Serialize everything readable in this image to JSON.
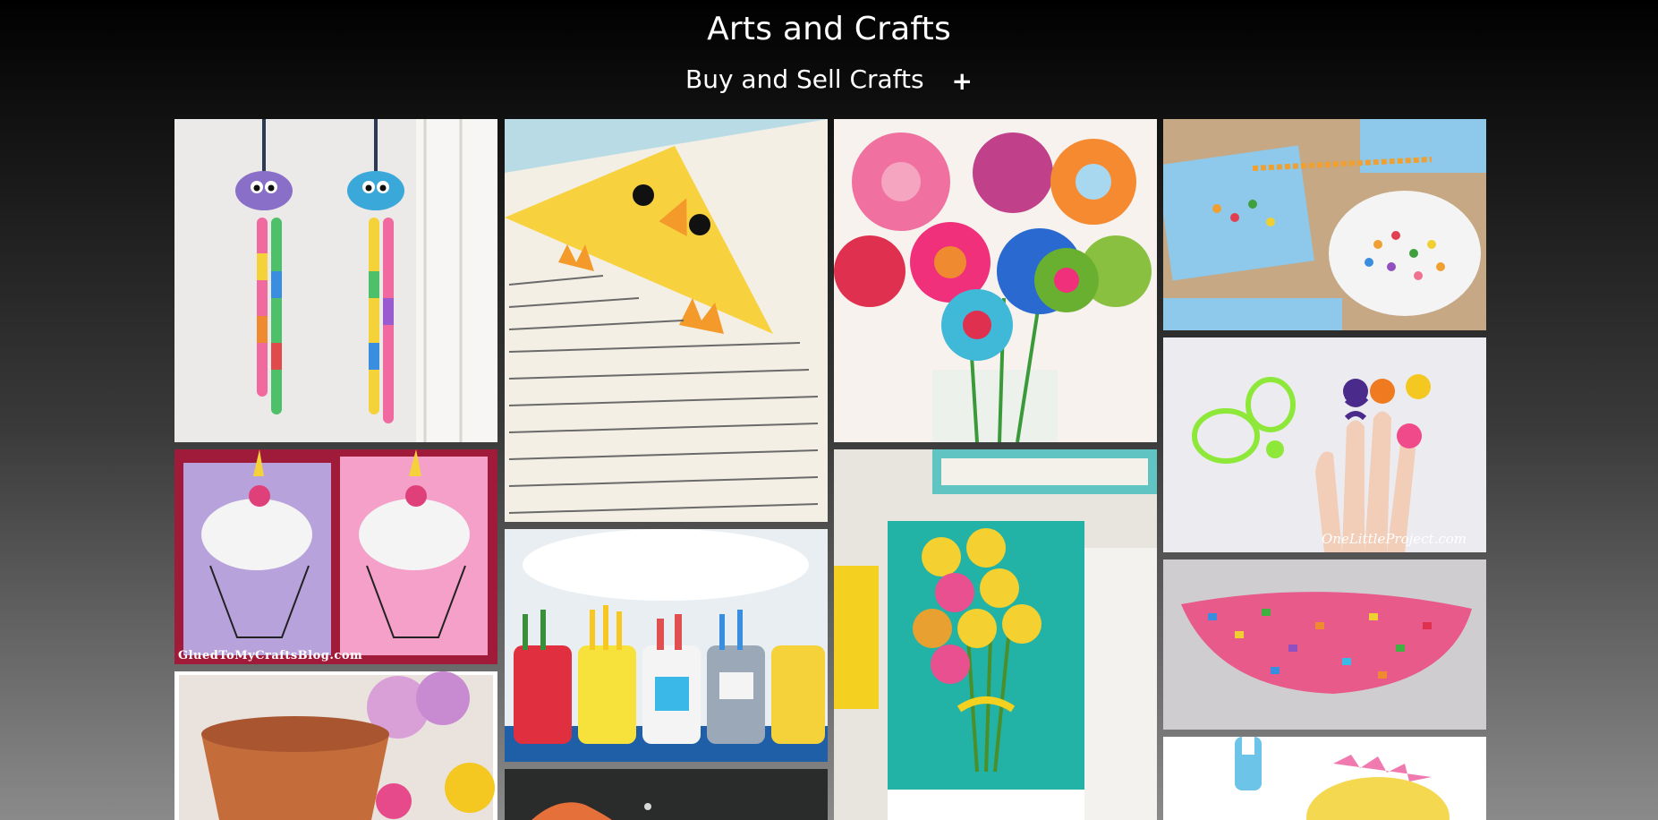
{
  "header": {
    "title": "Arts and Crafts",
    "subnav_label": "Buy and Sell Crafts",
    "expand_symbol": "+"
  },
  "gallery": {
    "tiles": [
      {
        "subject": "egg-carton jellyfish with beads",
        "credit": ""
      },
      {
        "subject": "cotton-ball unicorn cupcake cards",
        "credit": "GluedToMyCraftsBlog.com"
      },
      {
        "subject": "flower pot craft",
        "credit": ""
      },
      {
        "subject": "chick corner bookmark",
        "credit": ""
      },
      {
        "subject": "painted mason jar pencil holders",
        "credit": ""
      },
      {
        "subject": "chalkboard craft",
        "credit": ""
      },
      {
        "subject": "felt button flower bouquet",
        "credit": ""
      },
      {
        "subject": "egg-carton flower canvas",
        "credit": ""
      },
      {
        "subject": "cereal loop counting activity",
        "credit": ""
      },
      {
        "subject": "pipe cleaner finger puppets",
        "credit": "OneLittleProject.com"
      },
      {
        "subject": "melted bead bowl",
        "credit": ""
      },
      {
        "subject": "paper plate craft",
        "credit": ""
      }
    ]
  }
}
